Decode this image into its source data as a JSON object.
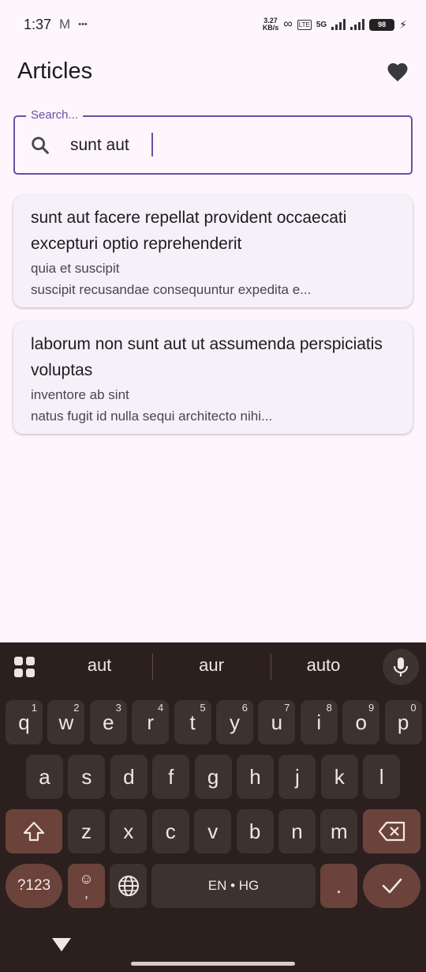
{
  "status_bar": {
    "time": "1:37",
    "mail_icon": "M",
    "more": "•••",
    "net_speed_value": "3.27",
    "net_speed_unit": "KB/s",
    "network": "5G",
    "battery": "98"
  },
  "app_bar": {
    "title": "Articles",
    "favorites_icon": "heart-icon"
  },
  "search": {
    "label": "Search...",
    "value": "sunt aut",
    "icon": "search-icon"
  },
  "articles": [
    {
      "title": "sunt aut facere repellat provident occaecati excepturi optio reprehenderit",
      "subtitle": "quia et suscipit",
      "body": "suscipit recusandae consequuntur expedita e..."
    },
    {
      "title": "laborum non sunt aut ut assumenda perspiciatis voluptas",
      "subtitle": "inventore ab sint",
      "body": "natus fugit id nulla sequi architecto nihi..."
    }
  ],
  "keyboard": {
    "suggestions": [
      "aut",
      "aur",
      "auto"
    ],
    "row1": [
      {
        "k": "q",
        "h": "1"
      },
      {
        "k": "w",
        "h": "2"
      },
      {
        "k": "e",
        "h": "3"
      },
      {
        "k": "r",
        "h": "4"
      },
      {
        "k": "t",
        "h": "5"
      },
      {
        "k": "y",
        "h": "6"
      },
      {
        "k": "u",
        "h": "7"
      },
      {
        "k": "i",
        "h": "8"
      },
      {
        "k": "o",
        "h": "9"
      },
      {
        "k": "p",
        "h": "0"
      }
    ],
    "row2": [
      "a",
      "s",
      "d",
      "f",
      "g",
      "h",
      "j",
      "k",
      "l"
    ],
    "row3": [
      "z",
      "x",
      "c",
      "v",
      "b",
      "n",
      "m"
    ],
    "num_key": "?123",
    "emoji_key": "☺",
    "comma": ",",
    "space_label": "EN • HG",
    "period": ".",
    "colors": {
      "keyboard_bg": "#2b201e",
      "key_bg": "#3d3230",
      "modifier_bg": "#6b433b",
      "accent": "#6750a4"
    }
  }
}
